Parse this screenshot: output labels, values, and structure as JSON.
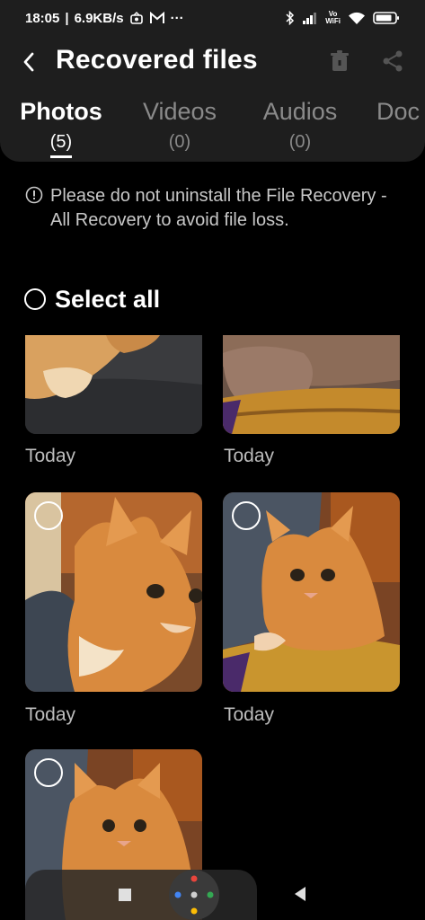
{
  "status_bar": {
    "time": "18:05",
    "speed": "6.9KB/s",
    "more": "···",
    "vowifi": [
      "Vo",
      "WiFi"
    ]
  },
  "header": {
    "title": "Recovered files"
  },
  "tabs": [
    {
      "label": "Photos",
      "count": "(5)",
      "active": true
    },
    {
      "label": "Videos",
      "count": "(0)",
      "active": false
    },
    {
      "label": "Audios",
      "count": "(0)",
      "active": false
    },
    {
      "label": "Doc",
      "count": "",
      "active": false
    }
  ],
  "notice": {
    "text": "Please do not uninstall the File Recovery - All Recovery to avoid file loss."
  },
  "select_all": {
    "label": "Select all"
  },
  "photos": [
    {
      "date": "Today"
    },
    {
      "date": "Today"
    },
    {
      "date": "Today"
    },
    {
      "date": "Today"
    },
    {
      "date": ""
    }
  ],
  "colors": {
    "background": "#000000",
    "panel": "#1e1e1e",
    "text_primary": "#ffffff",
    "text_secondary": "#8a8a8a",
    "notice_text": "#c8c8c8"
  }
}
